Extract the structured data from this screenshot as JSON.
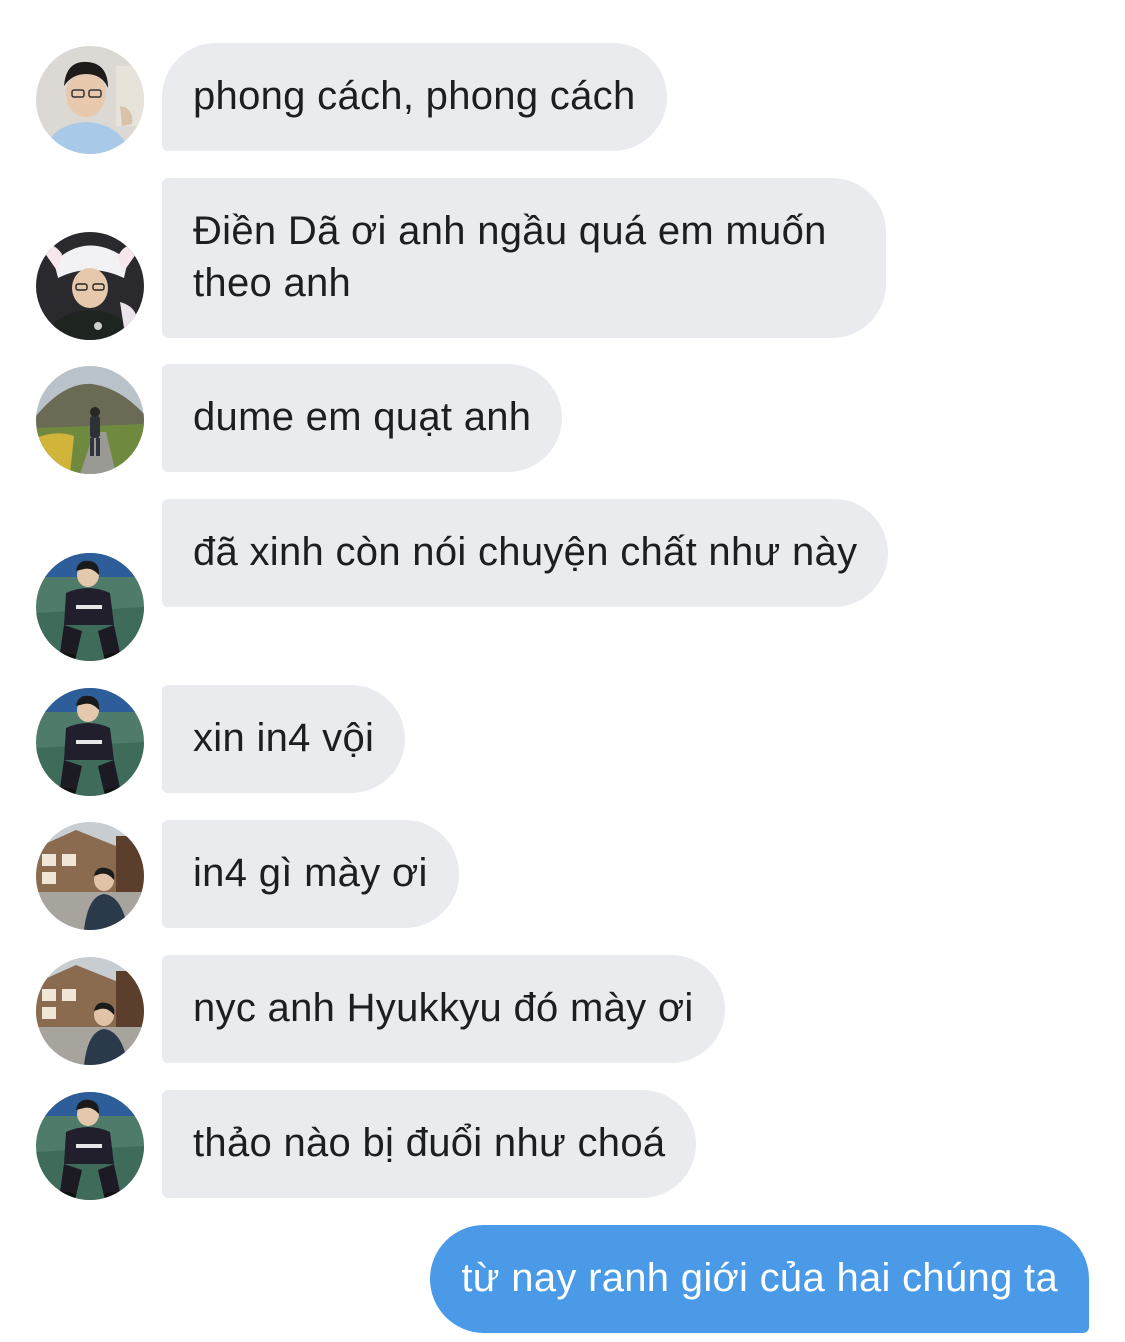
{
  "conversation": {
    "messages": [
      {
        "sender": "incoming",
        "avatar": "avatar-boy-glasses-icon",
        "text": "phong cách, phong cách"
      },
      {
        "sender": "incoming",
        "avatar": "avatar-boy-hat-icon",
        "text": "Điền Dã ơi anh ngầu quá em muốn theo anh"
      },
      {
        "sender": "incoming",
        "avatar": "avatar-mountain-landscape-icon",
        "text": "dume em quạt anh"
      },
      {
        "sender": "incoming",
        "avatar": "avatar-boy-squatting-icon",
        "text": "đã xinh còn nói chuyện chất như này"
      },
      {
        "sender": "incoming",
        "avatar": "avatar-boy-squatting-icon",
        "text": "xin in4 vội"
      },
      {
        "sender": "incoming",
        "avatar": "avatar-street-houses-icon",
        "text": "in4 gì mày ơi"
      },
      {
        "sender": "incoming",
        "avatar": "avatar-street-houses-icon",
        "text": "nyc anh Hyukkyu đó mày ơi"
      },
      {
        "sender": "incoming",
        "avatar": "avatar-boy-squatting-icon",
        "text": "thảo nào bị đuổi như choá"
      },
      {
        "sender": "outgoing",
        "text": "từ nay ranh giới của hai chúng ta"
      }
    ]
  },
  "colors": {
    "incoming_bubble": "#e9ebee",
    "outgoing_bubble": "#4a9ae8",
    "incoming_text": "#1c1e21",
    "outgoing_text": "#ffffff"
  }
}
